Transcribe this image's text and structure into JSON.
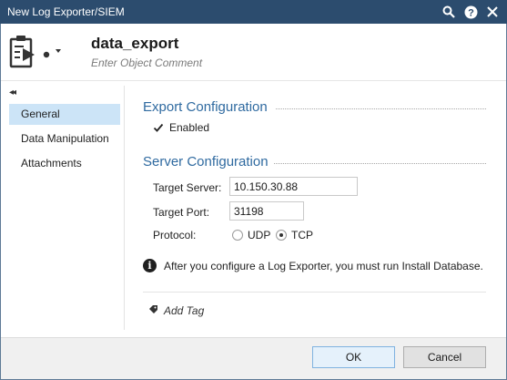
{
  "window": {
    "title": "New Log Exporter/SIEM",
    "icons": [
      "search-icon",
      "help-icon",
      "close-icon"
    ]
  },
  "header": {
    "object_icon": "log-exporter-icon",
    "object_name": "data_export",
    "comment_placeholder": "Enter Object Comment"
  },
  "sidebar": {
    "collapse_glyph": "◂◂",
    "items": [
      {
        "label": "General",
        "active": true
      },
      {
        "label": "Data Manipulation",
        "active": false
      },
      {
        "label": "Attachments",
        "active": false
      }
    ]
  },
  "export_config": {
    "title": "Export Configuration",
    "enabled_label": "Enabled",
    "enabled_checked": true
  },
  "server_config": {
    "title": "Server Configuration",
    "target_server_label": "Target Server:",
    "target_server_value": "10.150.30.88",
    "target_port_label": "Target Port:",
    "target_port_value": "31198",
    "protocol_label": "Protocol:",
    "protocol_options": [
      "UDP",
      "TCP"
    ],
    "protocol_selected": "TCP"
  },
  "info": {
    "icon": "info-icon",
    "message": "After you configure a Log Exporter, you must run Install Database."
  },
  "tags": {
    "add_tag_label": "Add Tag",
    "icon": "tag-icon"
  },
  "footer": {
    "ok_label": "OK",
    "cancel_label": "Cancel"
  },
  "colors": {
    "titlebar": "#2c4c6e",
    "section_title": "#2f6aa0",
    "nav_active": "#cce4f7",
    "primary_button_border": "#7fb2e0"
  }
}
